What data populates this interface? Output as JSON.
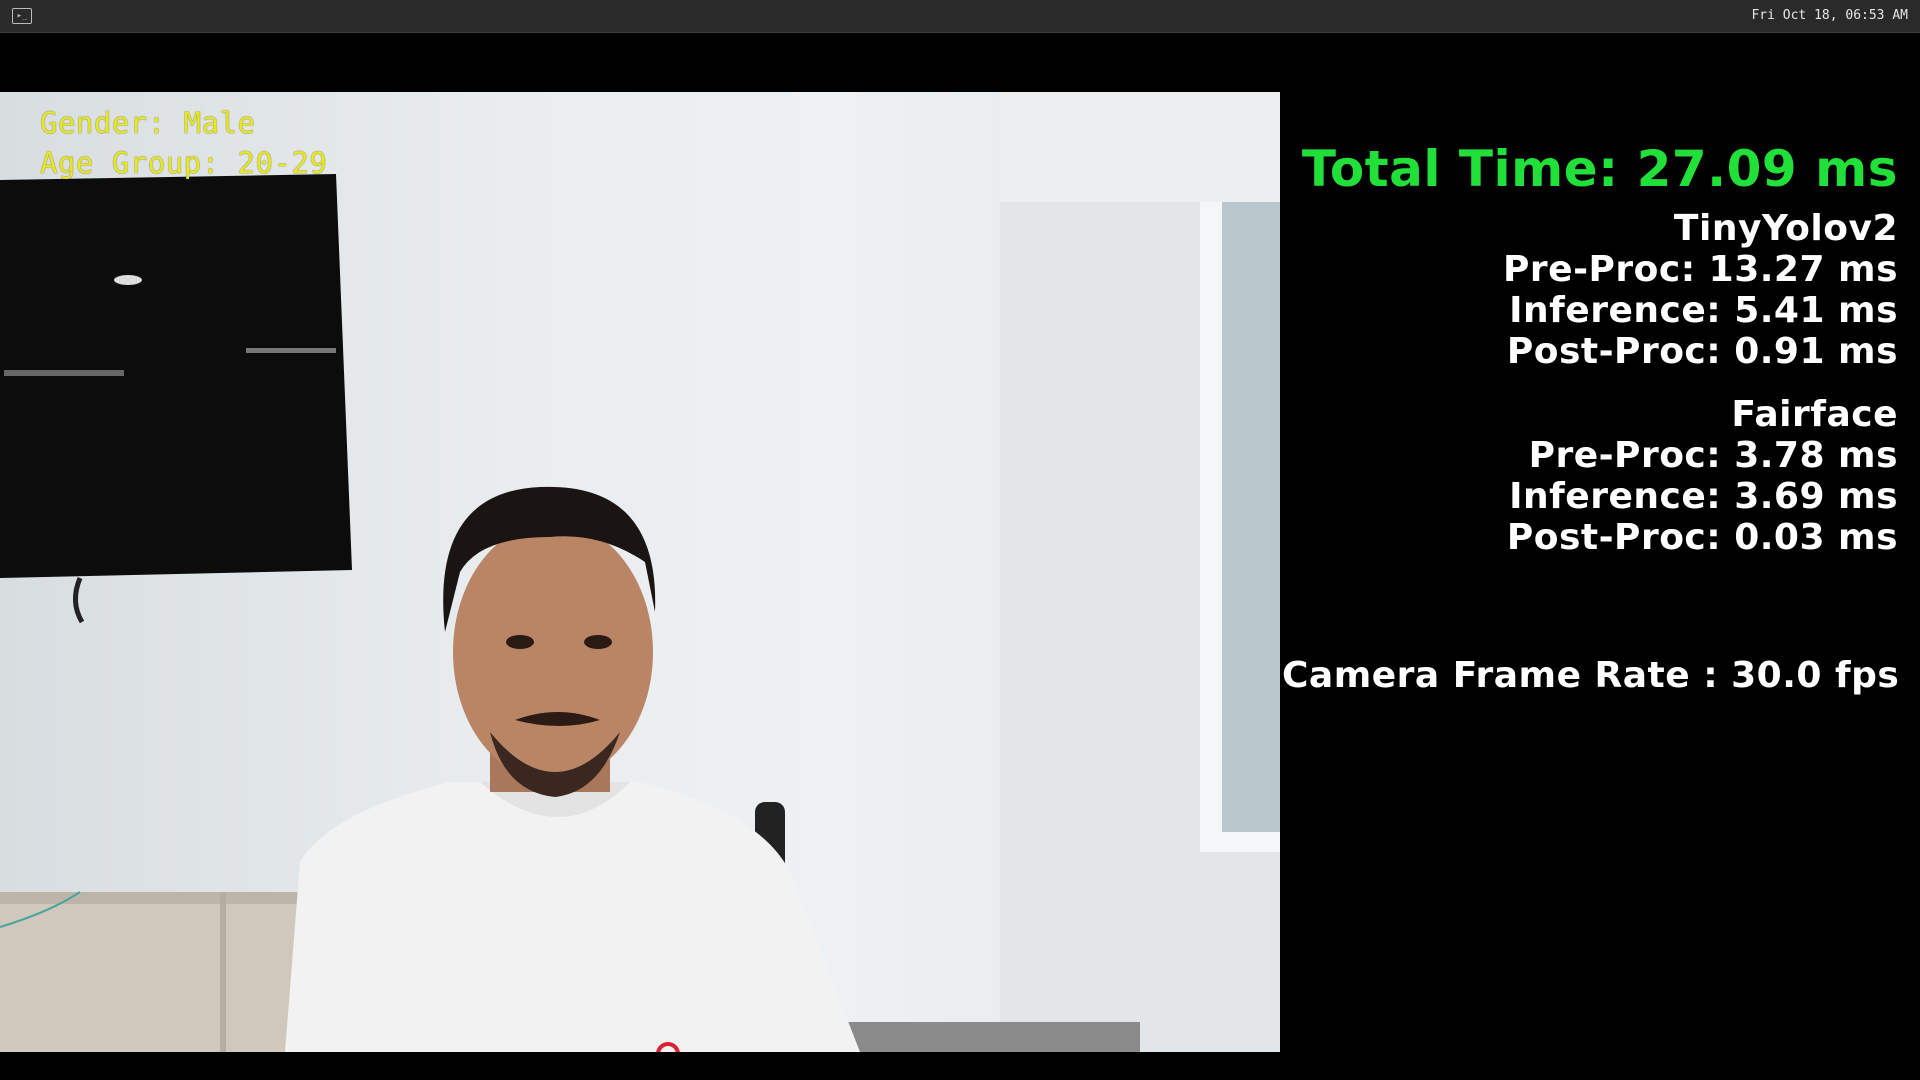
{
  "topbar": {
    "clock": "Fri Oct 18, 06:53 AM"
  },
  "overlay": {
    "gender": "Gender: Male",
    "age_group": "Age Group: 20-29"
  },
  "stats": {
    "total_time": "Total Time: 27.09 ms",
    "model1": {
      "name": "TinyYolov2",
      "pre_proc": "Pre-Proc: 13.27 ms",
      "inference": "Inference: 5.41 ms",
      "post_proc": "Post-Proc: 0.91 ms"
    },
    "model2": {
      "name": "Fairface",
      "pre_proc": "Pre-Proc: 3.78 ms",
      "inference": "Inference: 3.69 ms",
      "post_proc": "Post-Proc: 0.03 ms"
    },
    "camera_fps": "Camera Frame Rate : 30.0 fps"
  },
  "colors": {
    "total_time": "#22e03a",
    "overlay_text": "#e8e81a",
    "stats_text": "#ffffff"
  }
}
